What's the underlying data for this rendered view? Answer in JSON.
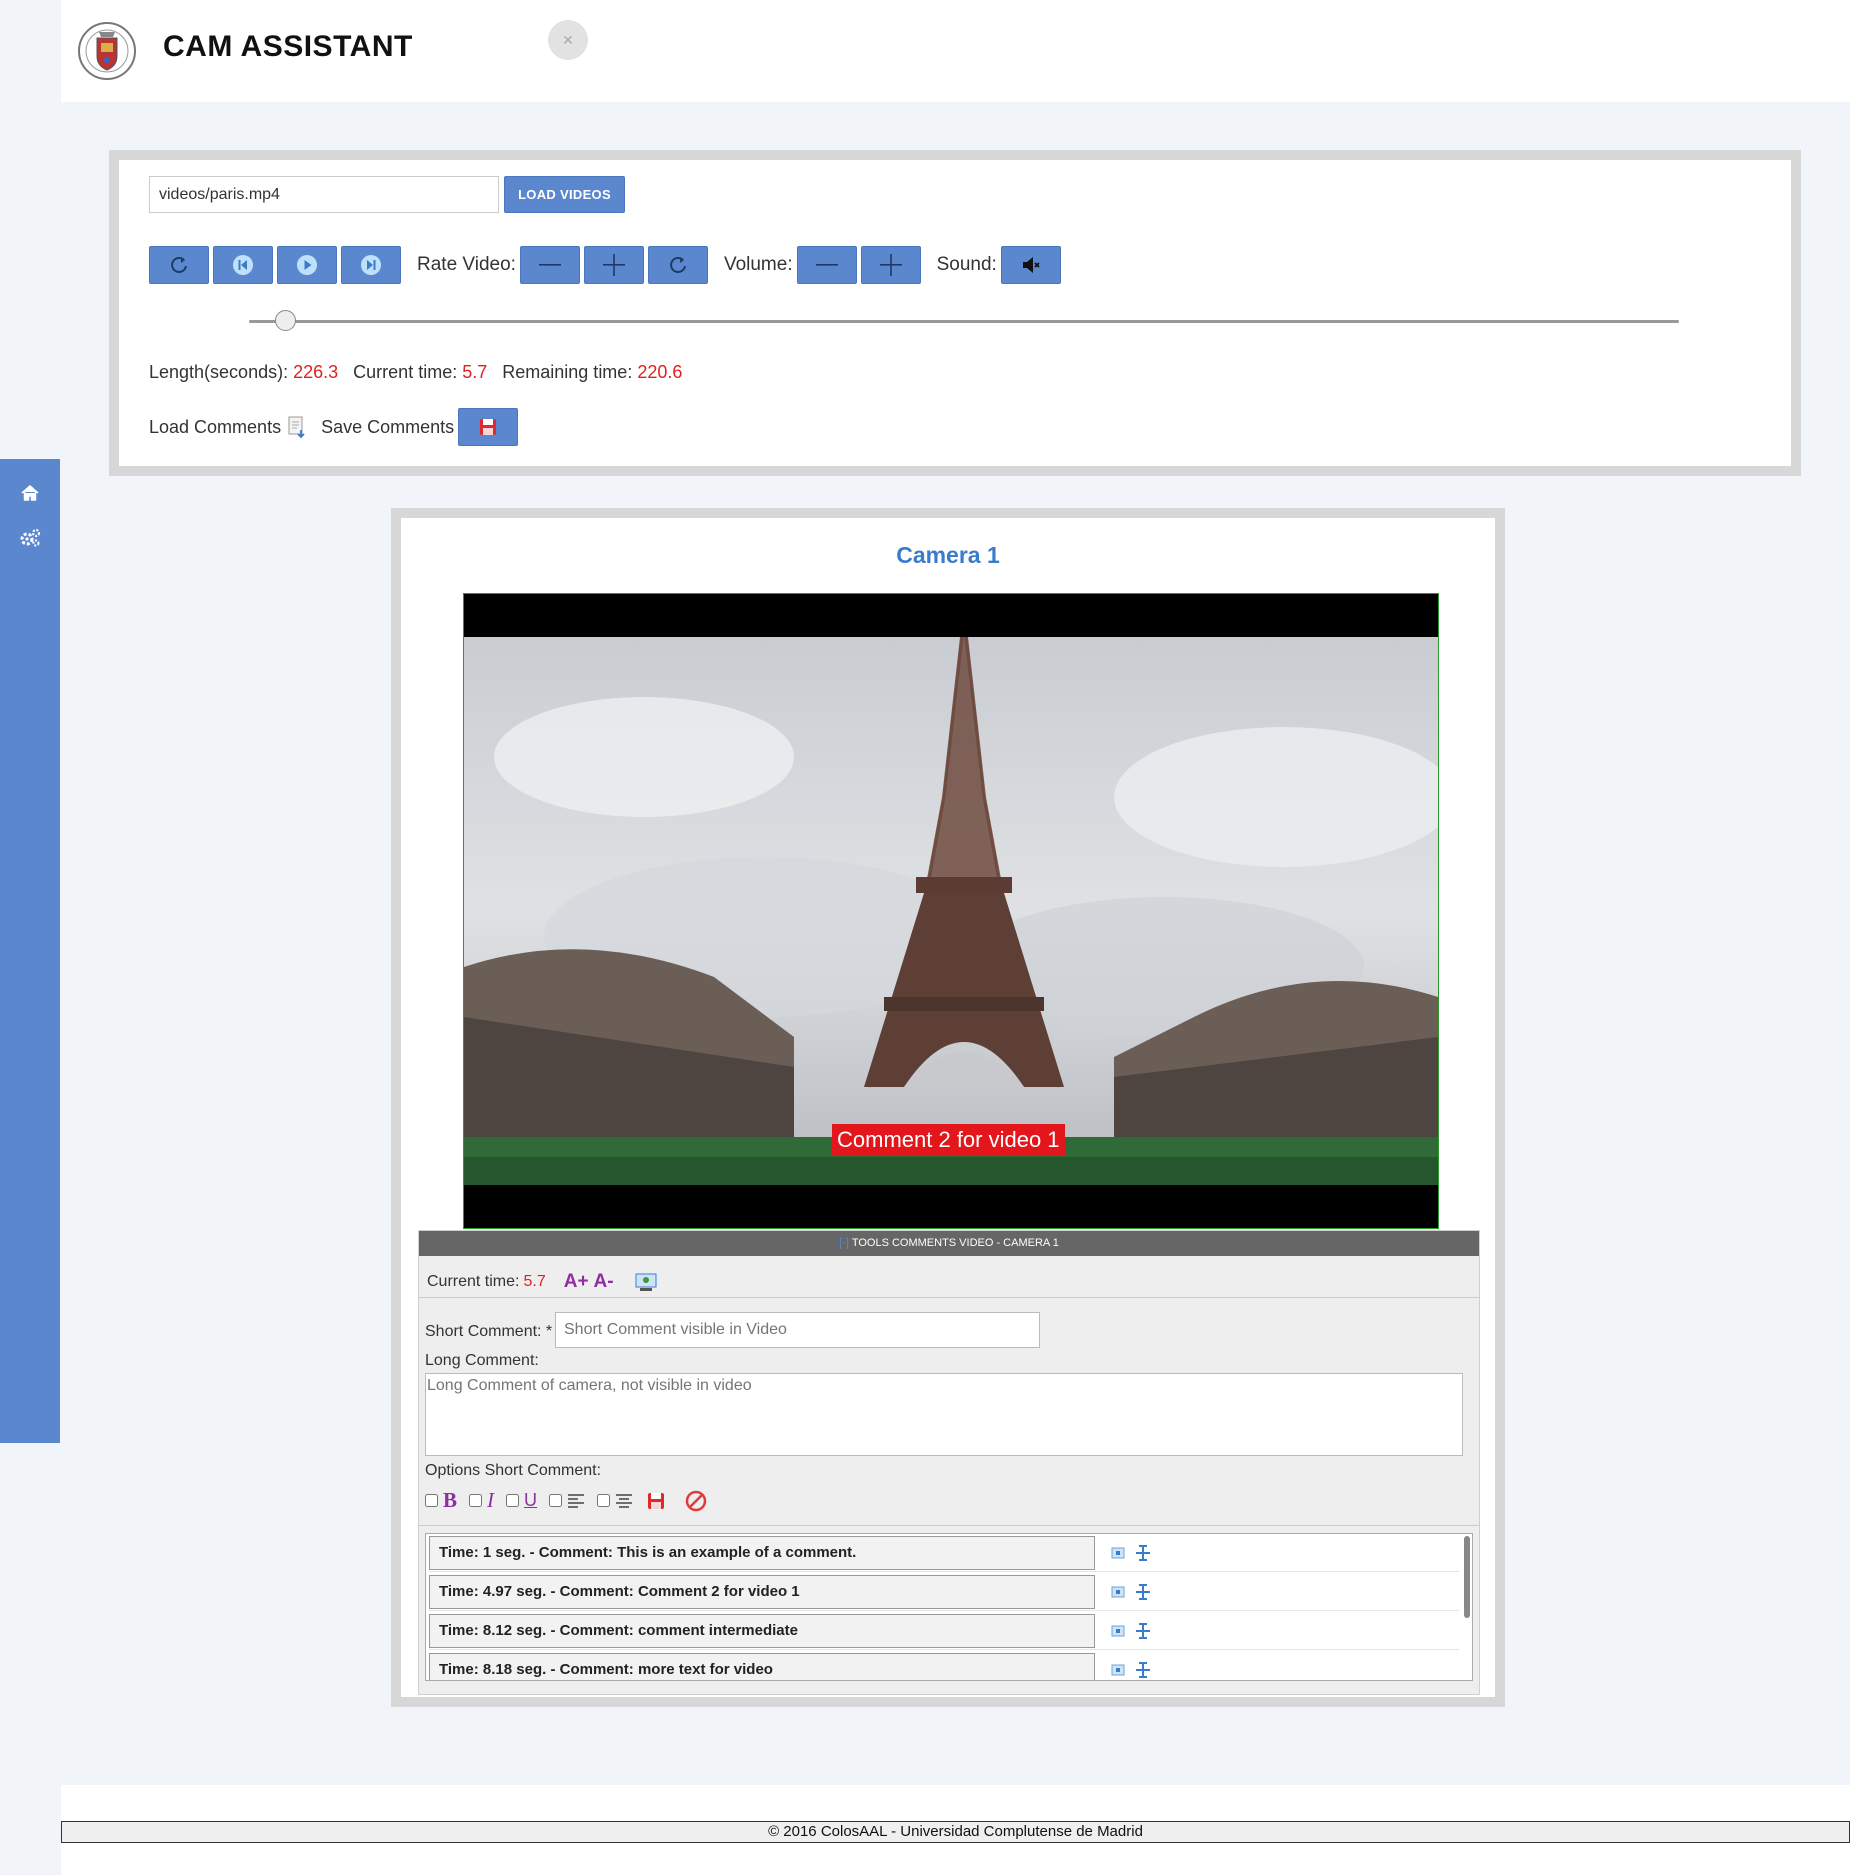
{
  "header": {
    "title": "CAM ASSISTANT",
    "collapse_icon": "expand-icon"
  },
  "sidebar": {
    "items": [
      {
        "icon": "home-icon"
      },
      {
        "icon": "gears-icon"
      }
    ]
  },
  "player": {
    "video_path": "videos/paris.mp4",
    "load_label": "LOAD VIDEOS",
    "rate_label": "Rate Video:",
    "volume_label": "Volume:",
    "sound_label": "Sound:",
    "progress": 0.025,
    "length_label": "Length(seconds):",
    "length_value": "226.3",
    "current_label": "Current time:",
    "current_value": "5.7",
    "remaining_label": "Remaining time:",
    "remaining_value": "220.6",
    "load_comments_label": "Load Comments",
    "save_comments_label": "Save Comments"
  },
  "camera": {
    "title": "Camera 1",
    "overlay_comment": "Comment 2 for video 1",
    "tools_title": "TOOLS COMMENTS VIDEO - CAMERA 1",
    "tools_expand": "[-]",
    "current_label": "Current time:",
    "current_value": "5.7",
    "font_bigger": "A+",
    "font_smaller": "A-",
    "short_label": "Short Comment: *",
    "short_placeholder": "Short Comment visible in Video",
    "long_label": "Long Comment:",
    "long_placeholder": "Long Comment of camera, not visible in video",
    "options_label": "Options Short Comment:",
    "bold": "B",
    "italic": "I",
    "underline": "U",
    "comments": [
      "Time: 1 seg. - Comment: This is an example of a comment.",
      "Time: 4.97 seg. - Comment: Comment 2 for video 1",
      "Time: 8.12 seg. - Comment: comment intermediate",
      "Time: 8.18 seg. - Comment: more text for video"
    ]
  },
  "footer": {
    "text": "© 2016 ColosAAL - Universidad Complutense de Madrid"
  },
  "colors": {
    "accent": "#5b87cf",
    "title_blue": "#3a7ccc",
    "value_red": "#e02020",
    "overlay_red": "#e3161b"
  }
}
